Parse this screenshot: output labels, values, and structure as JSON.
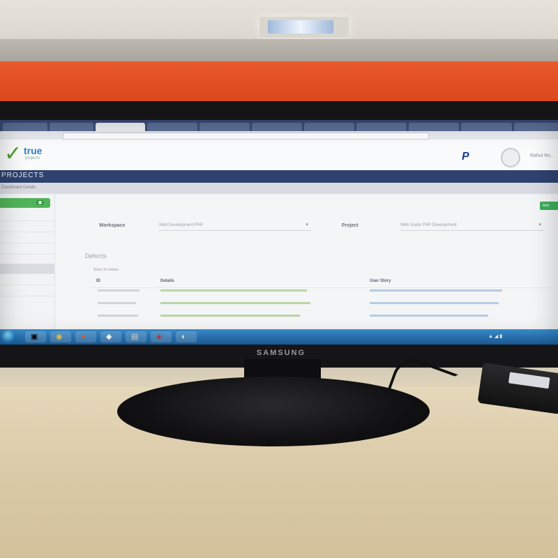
{
  "browser": {
    "tabs": [
      "",
      "",
      "",
      "",
      "",
      "",
      "",
      "",
      "",
      "",
      ""
    ]
  },
  "app": {
    "logo_text": "true",
    "logo_sub": "projects",
    "header_icon": "P",
    "user_name": "Rahul Ro..",
    "section_title": "PROJECTS",
    "breadcrumb": "Dashboard   Details"
  },
  "sidebar": {
    "items": [
      {
        "label": "",
        "count": ""
      },
      {
        "label": "",
        "count": ""
      },
      {
        "label": "",
        "count": ""
      },
      {
        "label": "",
        "count": ""
      },
      {
        "label": "",
        "count": ""
      },
      {
        "label": "",
        "count": ""
      },
      {
        "label": "",
        "count": ""
      },
      {
        "label": "",
        "count": ""
      }
    ]
  },
  "toolbar": {
    "add_label": "Add"
  },
  "filters": {
    "workspace_label": "Workspace",
    "workspace_value": "Web Development PHP",
    "project_label": "Project",
    "project_value": "Web Guide PHP Development"
  },
  "panel": {
    "title": "Defects",
    "show_entries": "Show 10 entries"
  },
  "table": {
    "columns": [
      "ID",
      "Details",
      "User Story"
    ],
    "rows": [
      {
        "id": "",
        "details": "",
        "story": ""
      },
      {
        "id": "",
        "details": "",
        "story": ""
      },
      {
        "id": "",
        "details": "",
        "story": ""
      }
    ]
  },
  "monitor": {
    "brand": "SAMSUNG"
  },
  "colors": {
    "accent_green": "#52b45a",
    "nav_blue": "#2f4270",
    "taskbar_blue": "#1d64a6",
    "partition_orange": "#e85a2c"
  }
}
